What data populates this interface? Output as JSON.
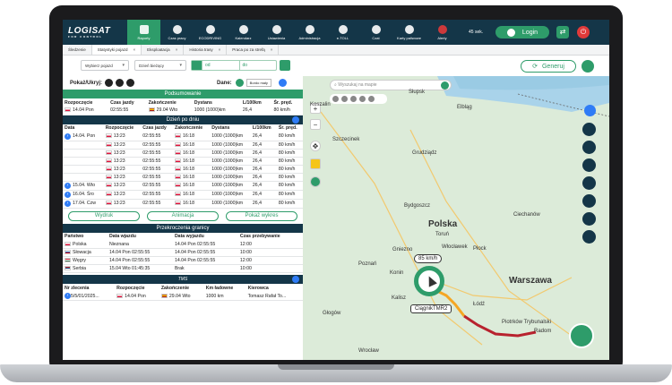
{
  "app": {
    "logo": "LOGISAT",
    "logo_sub": "FOR CONTROL",
    "timer": "45 sek.",
    "login": "Login"
  },
  "nav": [
    {
      "label": "Raporty",
      "icon": "report-icon",
      "active": true
    },
    {
      "label": "Czas pracy",
      "icon": "clock-icon"
    },
    {
      "label": "ECODRIVING",
      "icon": "leaf-icon"
    },
    {
      "label": "Kalendarz",
      "icon": "calendar-icon"
    },
    {
      "label": "Ustawienia",
      "icon": "gear-icon"
    },
    {
      "label": "Administracja",
      "icon": "admin-icon"
    },
    {
      "label": "e-TOLL",
      "icon": "toll-icon"
    },
    {
      "label": "Czat",
      "icon": "chat-icon"
    },
    {
      "label": "Karty paliwowe",
      "icon": "fuel-card-icon"
    },
    {
      "label": "Alerty",
      "icon": "bell-icon",
      "alert": true
    }
  ],
  "tabs": [
    {
      "label": "Śledzenie",
      "active": false,
      "close": false
    },
    {
      "label": "Statystyki pojazd",
      "active": true,
      "close": true
    },
    {
      "label": "Eksploatacja",
      "close": true
    },
    {
      "label": "Historia trasy",
      "close": true
    },
    {
      "label": "Praca po za strefą",
      "close": true
    }
  ],
  "filters": {
    "vehicle": "Wybierz pojazd",
    "period": "Dzień bieżący",
    "from": "od",
    "to": "do",
    "generate": "Generuj"
  },
  "left": {
    "show_label": "Pokaż/Ukryj:",
    "dane": "Dane:",
    "border": "Bordo mały"
  },
  "summary": {
    "title": "Podsumowanie",
    "headers": [
      "Rozpoczęcie",
      "Czas jazdy",
      "Zakończenie",
      "Dystans",
      "L/100km",
      "Śr. pręd."
    ],
    "row": [
      "14.04 Pon",
      "02:55:55",
      "29.04 Wto",
      "1000 (1000)km",
      "26,4",
      "80 km/h"
    ]
  },
  "daily": {
    "title": "Dzień po dniu",
    "headers": [
      "Data",
      "Rozpoczęcie",
      "Czas jazdy",
      "Zakończenie",
      "Dystans",
      "L/100km",
      "Śr. pręd."
    ],
    "rows": [
      {
        "date": "14.04. Pon",
        "start": "13:23",
        "drive": "02:55:55",
        "end": "16:18",
        "dist": "1000 (1000)km",
        "l": "26,4",
        "spd": "80 km/h",
        "expand": true
      },
      {
        "date": "",
        "start": "13:23",
        "drive": "02:55:55",
        "end": "16:18",
        "dist": "1000 (1000)km",
        "l": "26,4",
        "spd": "80 km/h"
      },
      {
        "date": "",
        "start": "13:23",
        "drive": "02:55:55",
        "end": "16:18",
        "dist": "1000 (1000)km",
        "l": "26,4",
        "spd": "80 km/h"
      },
      {
        "date": "",
        "start": "13:23",
        "drive": "02:55:55",
        "end": "16:18",
        "dist": "1000 (1000)km",
        "l": "26,4",
        "spd": "80 km/h"
      },
      {
        "date": "",
        "start": "13:23",
        "drive": "02:55:55",
        "end": "16:18",
        "dist": "1000 (1000)km",
        "l": "26,4",
        "spd": "80 km/h"
      },
      {
        "date": "",
        "start": "13:23",
        "drive": "02:55:55",
        "end": "16:18",
        "dist": "1000 (1000)km",
        "l": "26,4",
        "spd": "80 km/h"
      },
      {
        "date": "15.04. Wto",
        "start": "13:23",
        "drive": "02:55:55",
        "end": "16:18",
        "dist": "1000 (1000)km",
        "l": "26,4",
        "spd": "80 km/h",
        "expand": true
      },
      {
        "date": "16.04. Śro",
        "start": "13:23",
        "drive": "02:55:55",
        "end": "16:18",
        "dist": "1000 (1000)km",
        "l": "26,4",
        "spd": "80 km/h",
        "expand": true
      },
      {
        "date": "17.04. Czw",
        "start": "13:23",
        "drive": "02:55:55",
        "end": "16:18",
        "dist": "1000 (1000)km",
        "l": "26,4",
        "spd": "80 km/h",
        "expand": true
      }
    ]
  },
  "buttons": {
    "print": "Wydruk",
    "animation": "Animacja",
    "chart": "Pokaż wykres"
  },
  "borders": {
    "title": "Przekroczenia granicy",
    "headers": [
      "Państwo",
      "Data wjazdu",
      "Data wyjazdu",
      "Czas przebywanie"
    ],
    "rows": [
      {
        "country": "Polska",
        "flag": "pl",
        "in": "Nieznana",
        "out": "14.04 Pon 02:55:55",
        "time": "12:00"
      },
      {
        "country": "Słowacja",
        "flag": "sk",
        "in": "14.04 Pon 02:55:55",
        "out": "14.04 Pon 02:55:55",
        "time": "10:00"
      },
      {
        "country": "Węgry",
        "flag": "hu",
        "in": "14.04 Pon 02:55:55",
        "out": "14.04 Pon 02:55:55",
        "time": "12:00"
      },
      {
        "country": "Serbia",
        "flag": "rs",
        "in": "15.04 Wto 01:45:35",
        "out": "Brak",
        "time": "10:00"
      }
    ]
  },
  "tms": {
    "title": "TMS",
    "headers": [
      "Nr zlecenia",
      "Rozpoczęcie",
      "Zakończenie",
      "Km ładowne",
      "Kierowca"
    ],
    "row": [
      "5/5/01/2025...",
      "14.04 Pon",
      "29.04 Wto",
      "1000 km",
      "Tomasz Rafał To..."
    ]
  },
  "map": {
    "search_placeholder": "Wyszukaj na mapie",
    "speed": "85 km/h",
    "vehicle_label": "CiągnikTMR2",
    "cities": [
      {
        "name": "Polska",
        "big": true
      },
      {
        "name": "Koszalin"
      },
      {
        "name": "Elbląg"
      },
      {
        "name": "Słupsk"
      },
      {
        "name": "Szczecinek"
      },
      {
        "name": "Grudziądz"
      },
      {
        "name": "Bydgoszcz"
      },
      {
        "name": "Toruń"
      },
      {
        "name": "Włocławek"
      },
      {
        "name": "Płock"
      },
      {
        "name": "Gniezno"
      },
      {
        "name": "Poznań"
      },
      {
        "name": "Konin"
      },
      {
        "name": "Warszawa",
        "big": true
      },
      {
        "name": "Kalisz"
      },
      {
        "name": "Łódź"
      },
      {
        "name": "Piotrków Trybunalski"
      },
      {
        "name": "Radom"
      },
      {
        "name": "Głogów"
      },
      {
        "name": "Wrocław"
      },
      {
        "name": "Ciechanów"
      }
    ]
  }
}
